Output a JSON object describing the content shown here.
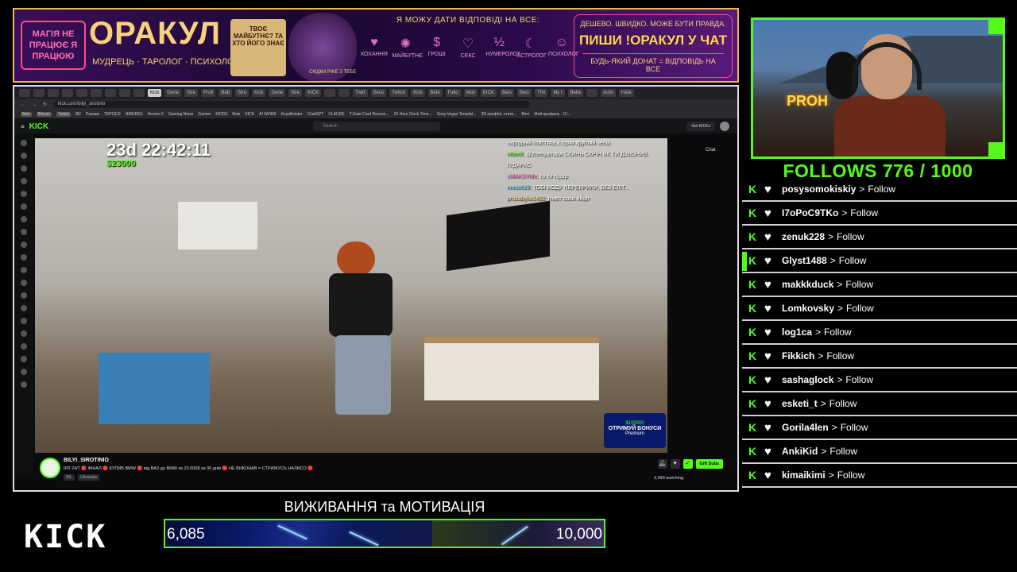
{
  "banner": {
    "left_text": "МАГІЯ НЕ ПРАЦЮЄ Я ПРАЦЮЮ",
    "title": "ОРАКУЛ",
    "subtitle": "МУДРЕЦЬ · ТАРОЛОГ · ПСИХОЛОГ",
    "book_text": "ТВОЄ МАЙБУТНЄ? ТА ХТО ЙОГО ЗНАЄ",
    "wizard_text": "СКІДКИ РЖЕ З ТЕБЕ",
    "mid_title": "Я МОЖУ ДАТИ ВІДПОВІДІ НА ВСЕ:",
    "categories": [
      {
        "icon": "♥",
        "label": "КОХАННЯ"
      },
      {
        "icon": "✺",
        "label": "МАЙБУТНЄ"
      },
      {
        "icon": "$",
        "label": "ГРОШІ"
      },
      {
        "icon": "♡",
        "label": "СЕКС"
      },
      {
        "icon": "½",
        "label": "НУМЕРОЛОГ"
      },
      {
        "icon": "☾",
        "label": "АСТРОЛОГ"
      },
      {
        "icon": "☺",
        "label": "ПСИХОЛОГ"
      }
    ],
    "right_top": "ДЕШЕВО. ШВИДКО. МОЖЕ БУТИ ПРАВДА.",
    "right_cta": "ПИШИ !ОРАКУЛ У ЧАТ",
    "right_bottom": "БУДЬ-ЯКИЙ ДОНАТ = ВІДПОВІДЬ НА ВСЕ"
  },
  "browser": {
    "tabs": [
      "",
      "",
      "",
      "",
      "",
      "",
      "",
      "",
      "",
      "Kick",
      "Gene",
      "Stre",
      "Profi",
      "Batt",
      "Stre",
      "Kick",
      "Gene",
      "Stre",
      "KICK",
      "",
      "",
      "Twitt",
      "Seco",
      "Twitch",
      "Kick",
      "Bebi",
      "Fallo",
      "Moti",
      "KICK",
      "Bets",
      "Bets",
      "Thri",
      "My I",
      "Bella",
      "",
      "Activ",
      "Hate"
    ],
    "active_tab": "Kick",
    "url": "kick.com/bilyi_sirotinio",
    "bookmarks": [
      "Bets",
      "Bitcoin",
      "Twitch",
      "BC",
      "Раззам",
      "TEPGEJI",
      "HIREBSS",
      "Heroes 5",
      "Gaming News",
      "Games",
      "MODS",
      "Bots",
      "KICK",
      "AI WORK",
      "KeysBoister",
      "ChatGPT",
      "CLAUDE",
      "T-Gate Card Recove...",
      "24 Hour Clock Time...",
      "Sony Vegas Templat...",
      "ЗD профілі, стати...",
      "Binn",
      "Мой профиль - Cl..."
    ]
  },
  "kick": {
    "logo": "KICK",
    "search_placeholder": "Search",
    "get_kicks": "Get KICKs",
    "chat_label": "Chat"
  },
  "video": {
    "timer": "23d 22:42:11",
    "money": "$23000",
    "chat": [
      {
        "user": "",
        "msg": "народний глистяка, і прям круглий челік"
      },
      {
        "user": "vitavol:",
        "msg": "@zhenyamatw СКИНЬ СКРІН ЯК ТИ ДЗВОНИВ. ПІДАРАС"
      },
      {
        "user": "xMAKSYMx:",
        "msg": "та ти підар"
      },
      {
        "user": "ennio619:",
        "msg": "ТОБІ ВОДУ ПЕРЕКРИЛИ, БЕЗ ЕЛІТ..."
      },
      {
        "user": "prozabyka1422:",
        "msg": "глист соси яйця"
      }
    ],
    "bonus_amount": "$100000",
    "bonus_label": "ОТРИМУЙ БОНУСИ",
    "bonus_sub": "Premium"
  },
  "stream": {
    "name": "BILYI_SIROTINIO",
    "title": "IРЛ 24/7 🔴 ФІНАЛ 🔴 КУПИВ BMW 🔴 від ВАЗ до BMW за 20.000$ за 30 днів 🔴 НЕ ВИКОНАВ = СТРИЖУСЬ НАЛИСО 🔴",
    "tags": [
      "IRL",
      "Ukrainian"
    ],
    "gift_subs": "Gift Subs",
    "watching": "2,990 watching"
  },
  "follows_title": "FOLLOWS 776 / 1000",
  "follow_list": [
    {
      "name": "posysomokiskiy",
      "action": "Follow"
    },
    {
      "name": "I7oPoC9TKo",
      "action": "Follow"
    },
    {
      "name": "zenuk228",
      "action": "Follow"
    },
    {
      "name": "Glyst1488",
      "action": "Follow"
    },
    {
      "name": "makkkduck",
      "action": "Follow"
    },
    {
      "name": "Lomkovsky",
      "action": "Follow"
    },
    {
      "name": "log1ca",
      "action": "Follow"
    },
    {
      "name": "Fikkich",
      "action": "Follow"
    },
    {
      "name": "sashaglock",
      "action": "Follow"
    },
    {
      "name": "esketi_t",
      "action": "Follow"
    },
    {
      "name": "Gorila4len",
      "action": "Follow"
    },
    {
      "name": "AnkiKid",
      "action": "Follow"
    },
    {
      "name": "kimaikimi",
      "action": "Follow"
    }
  ],
  "webcam": {
    "sign_text": "PROH"
  },
  "bottom": {
    "logo": "KICK",
    "goal_title": "ВИЖИВАННЯ та МОТИВАЦІЯ",
    "goal_current": "6,085",
    "goal_max": "10,000",
    "goal_progress": 0.6085
  },
  "colors": {
    "kick_green": "#53fc18"
  }
}
